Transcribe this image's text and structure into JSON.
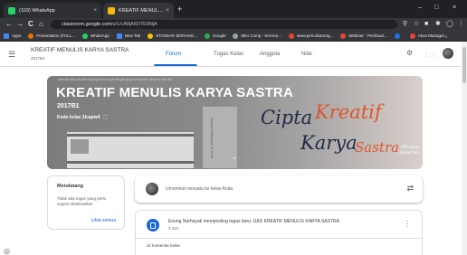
{
  "browser": {
    "tabs": [
      {
        "label": "(103) WhatsApp",
        "favicon_color": "#25d366",
        "close": "×"
      },
      {
        "label": "KREATIF MENULIS KARYA SASTR",
        "favicon_color": "#fbbc04",
        "close": "×"
      }
    ],
    "new_tab": "+",
    "window_controls": {
      "minimize": "–",
      "maximize": "□",
      "close": "×"
    },
    "nav": {
      "back": "←",
      "forward": "→",
      "reload": "C",
      "home": "⌂"
    },
    "url": {
      "host": "classroom.google.com",
      "path": "/u/1/c/MjA5OTE5NjA"
    },
    "toolbar_icons": {
      "search": "⚲",
      "star": "☆",
      "extension": "■",
      "puzzle": "✱",
      "profile": "◯",
      "menu": "⋮"
    },
    "bookmarks": [
      {
        "label": "Apps",
        "color": "#4285f4"
      },
      {
        "label": "Presentation (FULL...",
        "color": "#e8710a"
      },
      {
        "label": "WhatsApp",
        "color": "#25d366"
      },
      {
        "label": "New Tab",
        "color": "#4285f4"
      },
      {
        "label": "STANDAR BORANG...",
        "color": "#fbbc04"
      },
      {
        "label": "Google",
        "color": "#34a853"
      },
      {
        "label": "Mku Comp - Service...",
        "color": "#5f6368"
      },
      {
        "label": "www.penulisanrng...",
        "color": "#ea4335"
      },
      {
        "label": "Webinar - Pembuat...",
        "color": "#ea4335"
      },
      {
        "label": "",
        "color": "#1a73e8"
      },
      {
        "label": "Akun Manager",
        "color": "#ea4335"
      }
    ],
    "bookmarks_overflow": "»"
  },
  "header": {
    "menu_icon": "☰",
    "class_title": "KREATIF MENULIS KARYA SASTRA",
    "class_section": "2017B1",
    "tabs": [
      "Forum",
      "Tugas Kelas",
      "Anggota",
      "Nilai"
    ],
    "active_tab": "Forum",
    "icons": {
      "settings": "⚙",
      "apps": "⋮⋮⋮"
    }
  },
  "banner": {
    "topline": "Sebuah buku kreatif tentang cipta karya dengan gaya penulisan, dimana, dan kini",
    "title": "KREATIF MENULIS KARYA SASTRA",
    "section": "2017B1",
    "class_code_label": "Kode kelas",
    "class_code": "3lcapw4",
    "fullscreen_icon": "⛶",
    "spine_text": "Enung Nurhayati, M.Hum.",
    "expand_icon": "⌄",
    "art_text": [
      "Cipta",
      "Kreatif",
      "Karya",
      "Sastra"
    ],
    "theme_link_1": "Pilih tema",
    "theme_link_2": "Upload foto"
  },
  "upcoming": {
    "title": "Mendatang",
    "text": "Tidak ada tugas yang perlu segera diselesaikan",
    "link": "Lihat semua"
  },
  "composer": {
    "placeholder": "Umumkan sesuatu ke kelas Anda",
    "repost_icon": "⇄"
  },
  "post": {
    "title": "Enung Nurhayati memposting tugas baru: GAS KREATIF MENULIS KARYA SASTRA",
    "date": "3 Jun",
    "menu_icon": "⋮",
    "comments": "41 komentar kelas"
  },
  "bottom_icon": "◎"
}
